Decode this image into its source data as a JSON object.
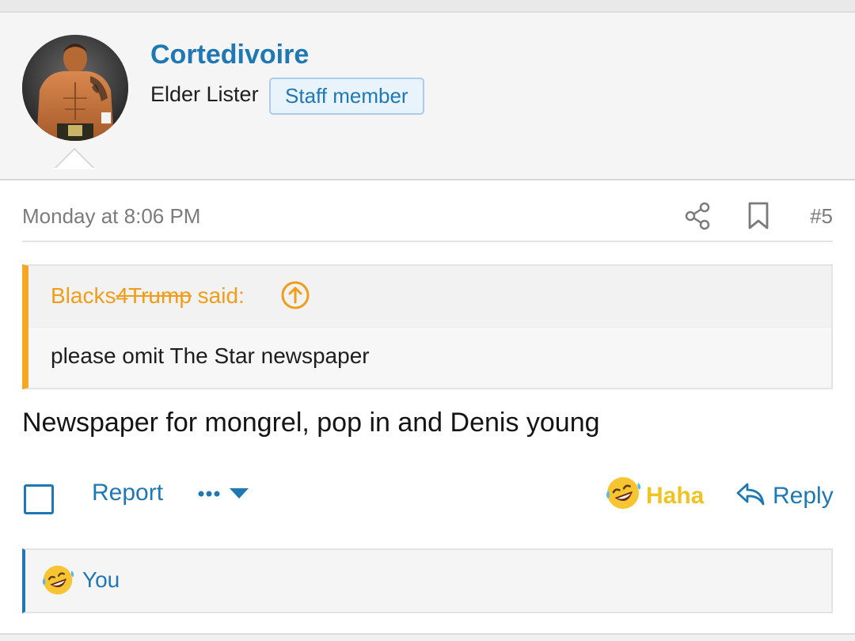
{
  "user": {
    "name": "Cortedivoire",
    "title": "Elder Lister",
    "badge": "Staff member",
    "avatar": "avatar-photo"
  },
  "post": {
    "date": "Monday at 8:06 PM",
    "number": "#5",
    "icons": {
      "share": "share-icon",
      "bookmark": "bookmark-icon"
    },
    "quote": {
      "author_prefix": "Blacks",
      "author_struck": "4Trump",
      "said": " said:",
      "jump_icon": "arrow-circle-up-icon",
      "text": "please omit The Star newspaper"
    },
    "body": "Newspaper for mongrel, pop in and Denis young"
  },
  "actions": {
    "report": "Report",
    "more_icon": "ellipsis-dropdown-icon",
    "reaction_label": "Haha",
    "reply_label": "Reply"
  },
  "reactions": {
    "emoji": "laughing-emoji-icon",
    "users": "You"
  },
  "colors": {
    "link": "#1f78b4",
    "quote_accent": "#f5a623",
    "haha": "#f0c324",
    "header_bg": "#f5f5f5"
  }
}
